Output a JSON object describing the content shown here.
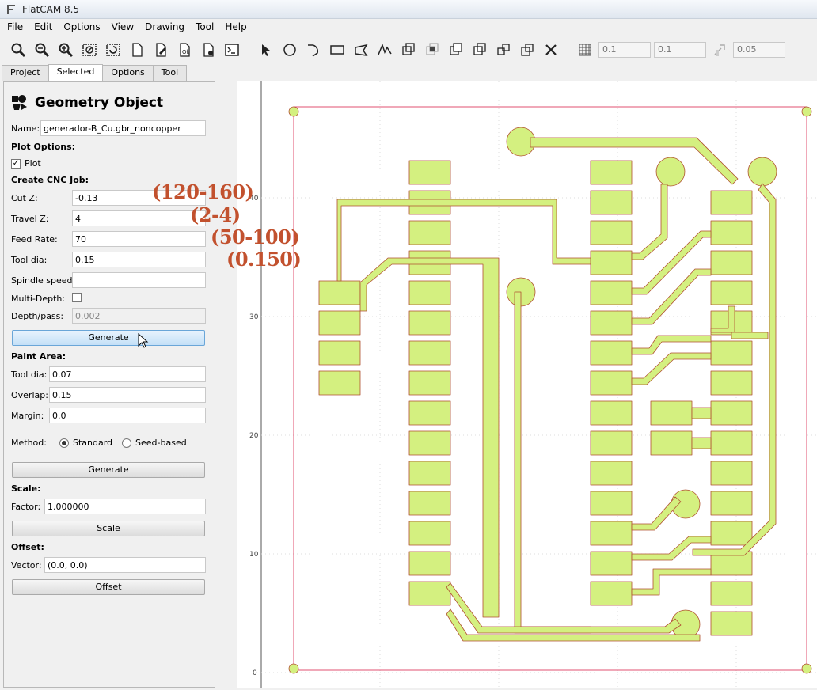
{
  "window": {
    "title": "FlatCAM 8.5"
  },
  "menu": [
    "File",
    "Edit",
    "Options",
    "View",
    "Drawing",
    "Tool",
    "Help"
  ],
  "toolbar": {
    "grid_x": "0.1",
    "grid_y": "0.1",
    "snap_max": "0.05",
    "icons": [
      "zoom-fit-icon",
      "zoom-in-icon",
      "zoom-out-icon",
      "clear-plot-icon",
      "replot-icon",
      "new-geometry-icon",
      "edit-geometry-icon",
      "update-geometry-icon",
      "delete-icon",
      "shell-icon",
      "select-icon",
      "circle-icon",
      "arc-icon",
      "rectangle-icon",
      "polygon-icon",
      "path-icon",
      "union-icon",
      "intersection-icon",
      "subtract-icon",
      "cut-icon",
      "buffer-icon",
      "move-icon",
      "copy-icon",
      "delete-shape-icon",
      "grid-snap-icon",
      "corner-snap-icon"
    ]
  },
  "tabs": [
    "Project",
    "Selected",
    "Options",
    "Tool"
  ],
  "panel": {
    "title": "Geometry Object",
    "name_label": "Name:",
    "name_value": "generador-B_Cu.gbr_noncopper",
    "plot_options": "Plot Options:",
    "plot_label": "Plot",
    "cnc_header": "Create CNC Job:",
    "cut_z_label": "Cut Z:",
    "cut_z": "-0.13",
    "travel_z_label": "Travel Z:",
    "travel_z": "4",
    "feed_label": "Feed Rate:",
    "feed": "70",
    "tooldia_label": "Tool dia:",
    "tooldia": "0.15",
    "spindle_label": "Spindle speed:",
    "spindle": "",
    "multidepth_label": "Multi-Depth:",
    "depth_label": "Depth/pass:",
    "depth": "0.002",
    "generate": "Generate",
    "paint_header": "Paint Area:",
    "paint_tooldia_label": "Tool dia:",
    "paint_tooldia": "0.07",
    "overlap_label": "Overlap:",
    "overlap": "0.15",
    "margin_label": "Margin:",
    "margin": "0.0",
    "method_label": "Method:",
    "method_standard": "Standard",
    "method_seed": "Seed-based",
    "paint_generate": "Generate",
    "scale_header": "Scale:",
    "factor_label": "Factor:",
    "factor": "1.000000",
    "scale_btn": "Scale",
    "offset_header": "Offset:",
    "vector_label": "Vector:",
    "vector": "(0.0, 0.0)",
    "offset_btn": "Offset"
  },
  "annotations": [
    "(120-160)",
    "(2-4)",
    "(50-100)",
    "(0.150)"
  ],
  "axis": {
    "y_ticks": [
      "40",
      "30",
      "20",
      "10",
      "0"
    ]
  }
}
